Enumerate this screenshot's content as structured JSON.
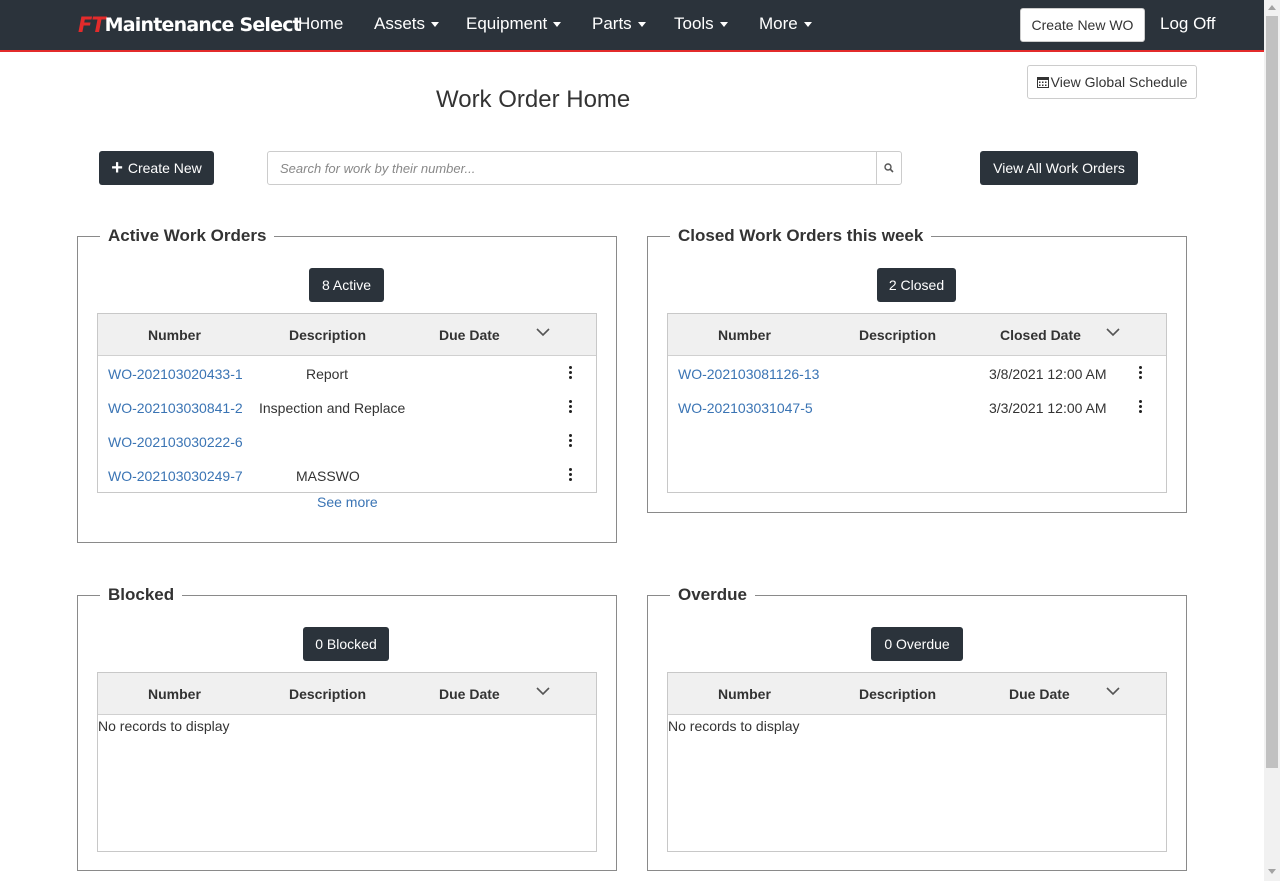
{
  "nav": {
    "brand_ft": "FT",
    "brand_rest": "Maintenance Select",
    "items": [
      {
        "label": "Home"
      },
      {
        "label": "Assets"
      },
      {
        "label": "Equipment"
      },
      {
        "label": "Parts"
      },
      {
        "label": "Tools"
      },
      {
        "label": "More"
      }
    ],
    "create_wo": "Create New WO",
    "logoff": "Log Off"
  },
  "header": {
    "global_schedule": "View Global Schedule",
    "title": "Work Order Home",
    "create_new": "Create New",
    "search_placeholder": "Search for work by their number...",
    "view_all": "View All Work Orders"
  },
  "active": {
    "legend": "Active Work Orders",
    "badge": "8 Active",
    "columns": [
      "Number",
      "Description",
      "Due Date"
    ],
    "rows": [
      {
        "number": "WO-202103020433-1",
        "description": "Report",
        "due": ""
      },
      {
        "number": "WO-202103030841-2",
        "description": "Inspection and Replace",
        "due": ""
      },
      {
        "number": "WO-202103030222-6",
        "description": "",
        "due": ""
      },
      {
        "number": "WO-202103030249-7",
        "description": "MASSWO",
        "due": ""
      }
    ],
    "see_more": "See more"
  },
  "closed": {
    "legend": "Closed Work Orders this week",
    "badge": "2 Closed",
    "columns": [
      "Number",
      "Description",
      "Closed Date"
    ],
    "rows": [
      {
        "number": "WO-202103081126-13",
        "description": "",
        "closed": "3/8/2021 12:00 AM"
      },
      {
        "number": "WO-202103031047-5",
        "description": "",
        "closed": "3/3/2021 12:00 AM"
      }
    ]
  },
  "blocked": {
    "legend": "Blocked",
    "badge": "0 Blocked",
    "columns": [
      "Number",
      "Description",
      "Due Date"
    ],
    "empty": "No records to display"
  },
  "overdue": {
    "legend": "Overdue",
    "badge": "0 Overdue",
    "columns": [
      "Number",
      "Description",
      "Due Date"
    ],
    "empty": "No records to display"
  },
  "colors": {
    "navbar": "#2b333b",
    "accent_red": "#e32b2b",
    "link": "#3a74b4",
    "button_dark": "#2b333b"
  },
  "icons": {
    "calendar": "calendar-icon",
    "plus": "plus-icon",
    "search": "search-icon",
    "chevron": "chevron-down-icon",
    "kebab": "kebab-menu-icon"
  }
}
